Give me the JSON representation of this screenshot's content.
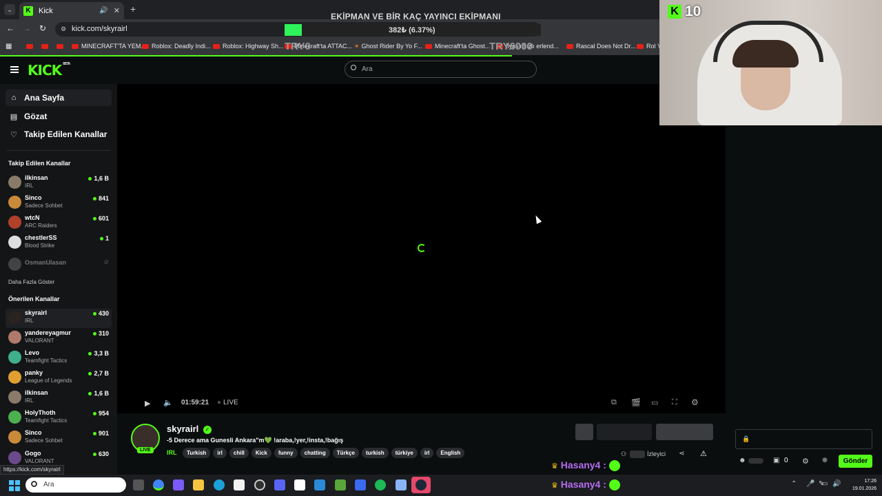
{
  "browser": {
    "tab_title": "Kick",
    "url": "kick.com/skyrairl",
    "status_url": "https://kick.com/skyrairl",
    "bookmarks": [
      "MINECRAFT'TA YEM...",
      "Roblox: Deadly Indi...",
      "Roblox: Highway Sh...",
      "Minecraft'ta ATTAC...",
      "Ghost Rider By Yo F...",
      "Minecraft'ta Ghost...",
      "İlyas'ı hızlı erlend...",
      "Rascal Does Not Dr...",
      "Rol Y"
    ]
  },
  "overlay": {
    "title": "EKİPMAN VE BİR KAÇ YAYINCI EKİPMANI",
    "progress_text": "382₺ (6.37%)",
    "progress_fraction": 0.0637,
    "current": "TRY0",
    "goal": "TRY6000"
  },
  "header": {
    "logo": "KICK",
    "logo_badge": "BETA",
    "search_placeholder": "Ara"
  },
  "sidebar": {
    "nav": [
      {
        "label": "Ana Sayfa",
        "icon": "home-icon"
      },
      {
        "label": "Gözat",
        "icon": "browse-icon"
      },
      {
        "label": "Takip Edilen Kanallar",
        "icon": "heart-icon"
      }
    ],
    "followed_title": "Takip Edilen Kanallar",
    "followed": [
      {
        "name": "ilkinsan",
        "category": "IRL",
        "viewers": "1,6 B"
      },
      {
        "name": "Sinco",
        "category": "Sadece Sohbet",
        "viewers": "841"
      },
      {
        "name": "wtcN",
        "category": "ARC Raiders",
        "viewers": "601"
      },
      {
        "name": "chestlerSS",
        "category": "Blood Strike",
        "viewers": "1"
      }
    ],
    "offline_channel": "OsmanUlasan",
    "show_more": "Daha Fazla Göster",
    "recommended_title": "Önerilen Kanallar",
    "recommended": [
      {
        "name": "skyrairl",
        "category": "IRL",
        "viewers": "430"
      },
      {
        "name": "yandereyagmur",
        "category": "VALORANT",
        "viewers": "310"
      },
      {
        "name": "Levo",
        "category": "Teamfight Tactics",
        "viewers": "3,3 B"
      },
      {
        "name": "panky",
        "category": "League of Legends",
        "viewers": "2,7 B"
      },
      {
        "name": "ilkinsan",
        "category": "IRL",
        "viewers": "1,6 B"
      },
      {
        "name": "HolyThoth",
        "category": "Teamfight Tactics",
        "viewers": "954"
      },
      {
        "name": "Sinco",
        "category": "Sadece Sohbet",
        "viewers": "901"
      },
      {
        "name": "Gogo",
        "category": "VALORANT",
        "viewers": "630"
      }
    ]
  },
  "player": {
    "time": "01:59:21",
    "live_label": "LIVE"
  },
  "stream": {
    "channel": "skyrairl",
    "live_badge": "LIVE",
    "title": "-5 Derece ama Gunesli Ankara\"m💚 !araba,!yer,!insta,!bağış",
    "category": "IRL",
    "tags": [
      "Turkish",
      "irl",
      "chill",
      "Kick",
      "funny",
      "chatting",
      "Türkçe",
      "turkish",
      "türkiye",
      "irl",
      "English"
    ],
    "viewers_label": "İzleyici"
  },
  "chat": {
    "send_label": "Gönder",
    "points": "0",
    "messages": [
      {
        "user": "Hasany4 :"
      },
      {
        "user": "Hasany4 :"
      }
    ]
  },
  "webcam": {
    "kick_count": "10"
  },
  "taskbar": {
    "search_placeholder": "Ara",
    "time": "17:26",
    "date": "19.01.2026"
  }
}
